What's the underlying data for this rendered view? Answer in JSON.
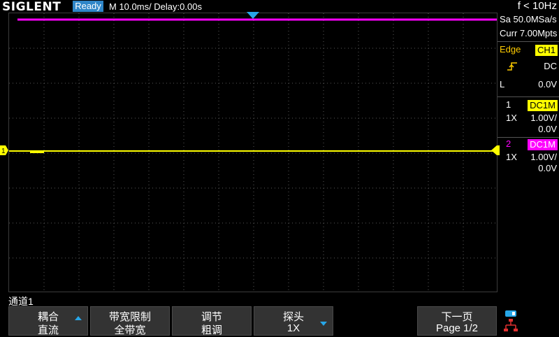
{
  "topbar": {
    "logo": "SIGLENT",
    "status": "Ready",
    "timebase": "M 10.0ms/ Delay:0.00s",
    "frequency": "f < 10Hz"
  },
  "acquisition": {
    "sample_rate": "Sa 50.0MSa/s",
    "memory_depth": "Curr 7.00Mpts"
  },
  "trigger": {
    "type": "Edge",
    "source": "CH1",
    "slope_icon": "rising-edge-icon",
    "coupling": "DC",
    "level_label": "L",
    "level": "0.0V"
  },
  "channels": [
    {
      "number": "1",
      "coupling": "DC1M",
      "probe": "1X",
      "scale": "1.00V/",
      "offset": "0.0V",
      "color": "#ffff00"
    },
    {
      "number": "2",
      "coupling": "DC1M",
      "probe": "1X",
      "scale": "1.00V/",
      "offset": "0.0V",
      "color": "#ff00ff"
    }
  ],
  "menu": {
    "title": "通道1",
    "softkeys": [
      {
        "line1": "耦合",
        "line2": "直流"
      },
      {
        "line1": "带宽限制",
        "line2": "全带宽"
      },
      {
        "line1": "调节",
        "line2": "粗调"
      },
      {
        "line1": "探头",
        "line2": "1X"
      },
      {
        "line1": "下一页",
        "line2": "Page 1/2"
      }
    ]
  },
  "colors": {
    "ch1": "#ffff00",
    "ch2": "#ff00ff",
    "accent": "#2f86c8",
    "grid": "#5a5a5a"
  }
}
